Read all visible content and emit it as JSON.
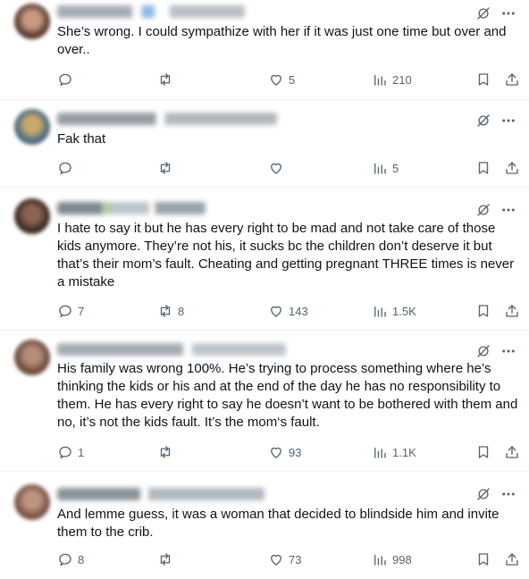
{
  "tweets": [
    {
      "text": "She’s wrong. I could sympathize with her if it was just one time but over and over..",
      "replies": "",
      "retweets": "",
      "likes": "5",
      "views": "210",
      "avatar_colors": [
        "#5a3a2e",
        "#c79a83"
      ],
      "name_colors": [
        "#9aa3ab",
        "#7fb2e5"
      ]
    },
    {
      "text": "Fak that",
      "replies": "",
      "retweets": "",
      "likes": "",
      "views": "5",
      "avatar_colors": [
        "#4a6a82",
        "#c8a96a"
      ],
      "name_colors": [
        "#8a939b",
        "#a9b1b8"
      ]
    },
    {
      "text": "I hate to say it but he has every right to be mad and not take care of those kids anymore. They’re not his, it sucks bc the children don’t deserve it but that’s their mom’s fault. Cheating and getting pregnant THREE times is never a mistake",
      "replies": "7",
      "retweets": "8",
      "likes": "143",
      "views": "1.5K",
      "avatar_colors": [
        "#3d2a22",
        "#8c6452"
      ],
      "name_colors": [
        "#6f7a83",
        "#a7c79a"
      ]
    },
    {
      "text": "His family was wrong 100%. He’s trying to process something where he’s thinking the kids or his and at the end of the day he has no responsibility to them. He has every right to say he doesn’t want to be bothered with them and no, it’s not the kids fault. It’s the mom‘s fault.",
      "replies": "1",
      "retweets": "",
      "likes": "93",
      "views": "1.1K",
      "avatar_colors": [
        "#6b4a3c",
        "#b58d78"
      ],
      "name_colors": [
        "#9aa3ab",
        "#b7bec4"
      ]
    },
    {
      "text": "And lemme guess, it was a woman that decided to blindside him and invite them to the crib.",
      "replies": "8",
      "retweets": "",
      "likes": "73",
      "views": "998",
      "avatar_colors": [
        "#7a5343",
        "#c09580"
      ],
      "name_colors": [
        "#7d868e",
        "#a9b1b8"
      ]
    }
  ]
}
